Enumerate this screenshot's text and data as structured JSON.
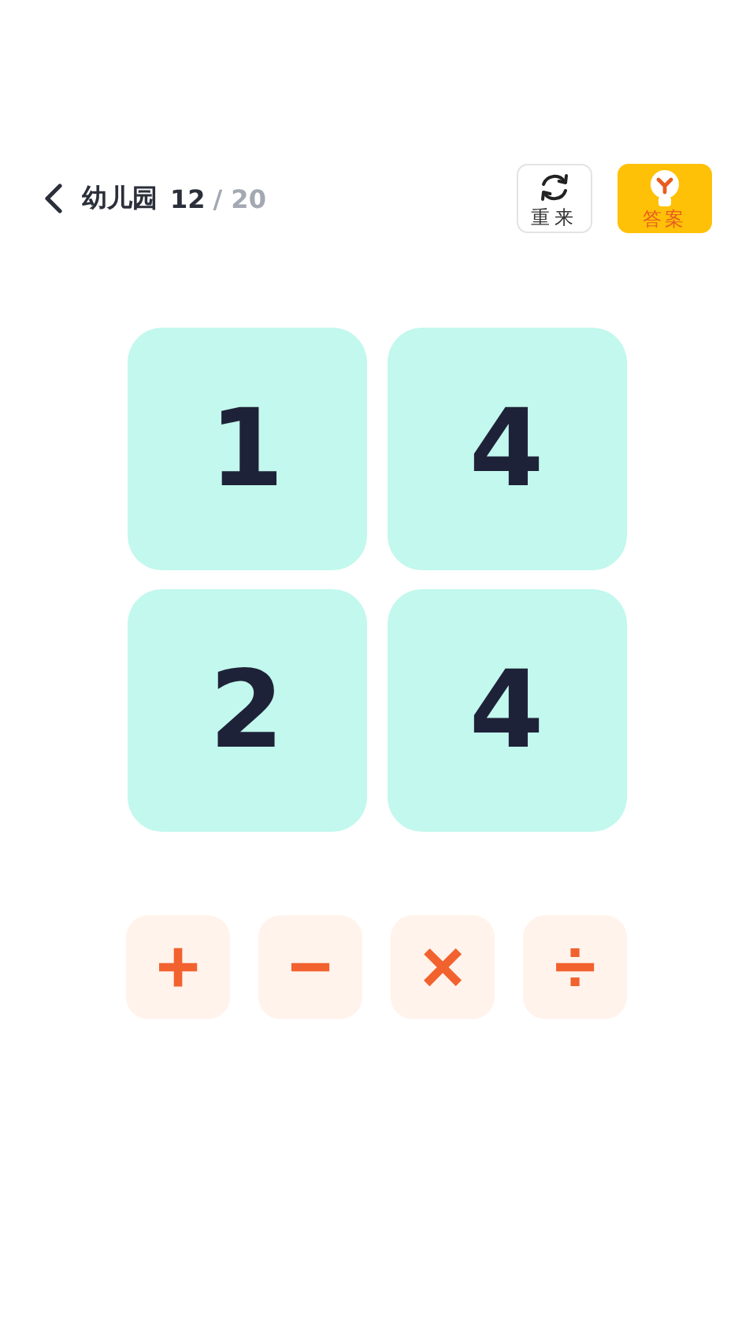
{
  "header": {
    "level_name": "幼儿园",
    "progress": "12",
    "total": "/ 20",
    "reset_label": "重来",
    "answer_label": "答案"
  },
  "cards": [
    "1",
    "4",
    "2",
    "4"
  ],
  "operators": [
    "+",
    "−",
    "×",
    "÷"
  ]
}
